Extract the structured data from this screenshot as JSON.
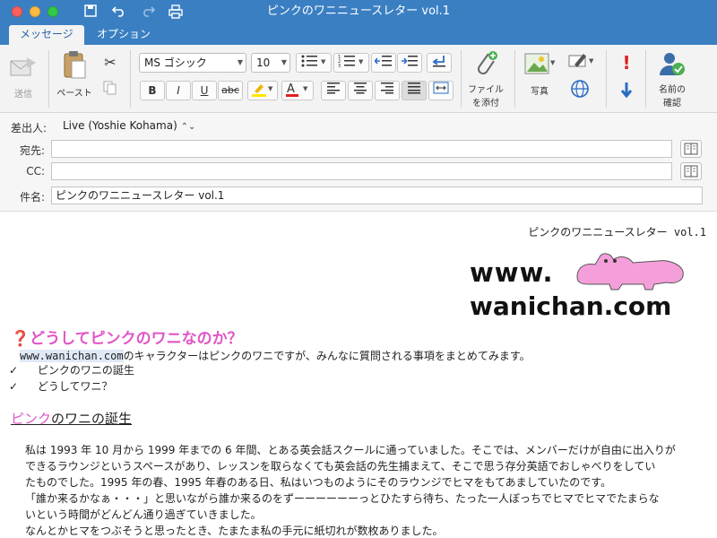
{
  "window": {
    "title": "ピンクのワニニュースレター vol.1"
  },
  "tabs": [
    {
      "label": "メッセージ"
    },
    {
      "label": "オプション"
    }
  ],
  "ribbon": {
    "send_label": "送信",
    "paste_label": "ペースト",
    "font_name": "MS ゴシック",
    "font_size": "10",
    "bold": "B",
    "italic": "I",
    "underline": "U",
    "strike": "abc",
    "attach_label_1": "ファイル",
    "attach_label_2": "を添付",
    "picture_label": "写真",
    "check_names_label_1": "名前の",
    "check_names_label_2": "確認"
  },
  "header": {
    "from_label": "差出人:",
    "from_value": "Live (Yoshie Kohama)",
    "to_label": "宛先:",
    "to_value": "",
    "cc_label": "CC:",
    "cc_value": "",
    "subject_label": "件名:",
    "subject_value": "ピンクのワニニュースレター vol.1"
  },
  "body": {
    "newsletter_title": "ピンクのワニニュースレター vol.1",
    "logo_line1": "www.",
    "logo_line2": "wanichan.com",
    "q_heading": "どうしてピンクのワニなのか？",
    "intro_link": "www.wanichan.com",
    "intro_text": "のキャラクターはピンクのワニですが、みんなに質問される事項をまとめてみます。",
    "checklist": [
      "ピンクのワニの誕生",
      "どうしてワニ？"
    ],
    "section_heading_link": "ピンク",
    "section_heading_rest": "のワニの誕生",
    "paragraphs": [
      "私は 1993 年 10 月から 1999 年までの 6 年間、とある英会話スクールに通っていました。そこでは、メンバーだけが自由に出入りが",
      "できるラウンジというスペースがあり、レッスンを取らなくても英会話の先生捕まえて、そこで思う存分英語でおしゃべりをしてい",
      "たものでした。1995 年の春、1995 年春のある日、私はいつものようにそのラウンジでヒマをもてあましていたのです。",
      "「誰か来るかなぁ・・・」と思いながら誰か来るのをずーーーーーーっとひたすら待ち、たった一人ぼっちでヒマでヒマでたまらな",
      "いという時間がどんどん通り過ぎていきました。",
      "なんとかヒマをつぶそうと思ったとき、たまたま私の手元に紙切れが数枚ありました。"
    ]
  }
}
